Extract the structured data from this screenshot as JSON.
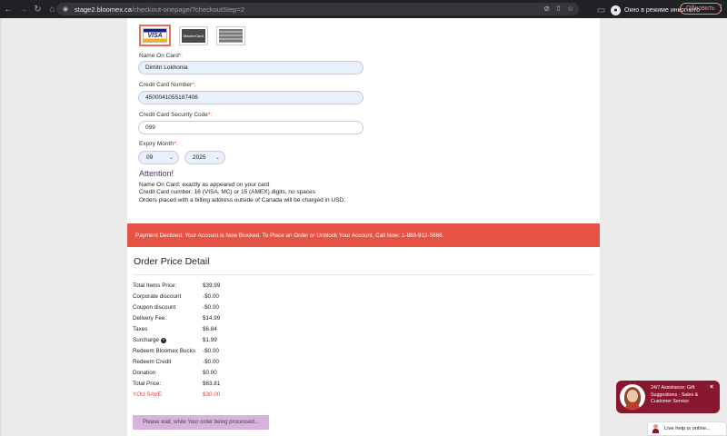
{
  "browser": {
    "url_host": "stage2.bloomex.ca",
    "url_path": "/checkout-onepage/?checkoutStep=2",
    "incognito_label": "Окно в режиме инкогнито",
    "update_label": "Обновить"
  },
  "payment_form": {
    "card_types": [
      "VISA",
      "MasterCard",
      "AMEX"
    ],
    "selected_card": "VISA",
    "name_label": "Name On Card",
    "name_value": "Dimitri Lokhonia",
    "number_label": "Credit Card Number",
    "number_value": "4500041055187406",
    "cvv_label": "Credit Card Security Code",
    "cvv_value": "099",
    "expiry_label": "Expiry Month",
    "expiry_month": "09",
    "expiry_year": "2025",
    "required_mark": "*:"
  },
  "attention": {
    "title": "Attention!",
    "lines": [
      "Name On Card: exactly as appeared on your card",
      "Credit Card number: 16 (VISA, MC) or 15 (AMEX) digits, no spaces",
      "Orders placed with a billing address outside of Canada will be charged in USD."
    ]
  },
  "decline_message": "Payment Declined. Your Account is Now Blocked. To Place an Order or Unblock Your Account, Call Now: 1-888-912-5666.",
  "order_summary": {
    "title": "Order Price Detail",
    "rows": [
      {
        "label": "Total Items Price:",
        "value": "$39.99"
      },
      {
        "label": "Corporate discount",
        "value": "-$0.00"
      },
      {
        "label": "Coupon discount",
        "value": "-$0.00"
      },
      {
        "label": "Delivery Fee:",
        "value": "$14.99"
      },
      {
        "label": "Taxes",
        "value": "$6.84"
      },
      {
        "label": "Surcharge",
        "value": "$1.99"
      },
      {
        "label": "Redeem Bloomex Bucks",
        "value": "-$0.00"
      },
      {
        "label": "Redeem Credit",
        "value": "-$0.00"
      },
      {
        "label": "Donation",
        "value": "$0.00"
      },
      {
        "label": "Total Price:",
        "value": "$63.81"
      },
      {
        "label": "YOU SAVE:",
        "value": "$30.00"
      }
    ],
    "surcharge_help": "?"
  },
  "processing_label": "Please wait, while Your order being processed...",
  "chat": {
    "text": "24/7 Assistance: Gift Suggestions - Sales & Customer Service",
    "close": "×",
    "live_help": "Live help is online..."
  },
  "colors": {
    "decline_bg": "#e55345",
    "processing_bg": "#d8b3dd",
    "chat_bg": "#8a1730",
    "attention": "#5b2a6e",
    "save": "#e53935"
  }
}
